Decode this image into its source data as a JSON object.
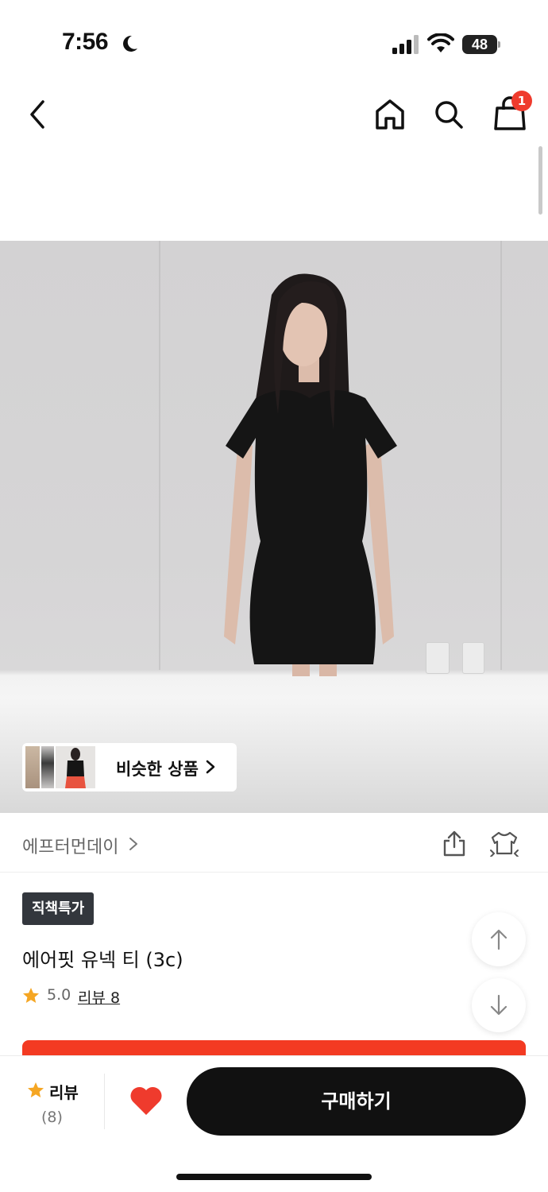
{
  "status_bar": {
    "time": "7:56",
    "battery": "48"
  },
  "nav": {
    "cart_count": "1",
    "icons": [
      "back-icon",
      "home-icon",
      "search-icon",
      "shopping-bag-icon"
    ]
  },
  "similar": {
    "label": "비슷한 상품"
  },
  "brand": {
    "name": "에프터먼데이"
  },
  "product": {
    "badge": "직책특가",
    "title": "에어핏 유넥 티 (3c)",
    "rating": "5.0",
    "review_link": "리뷰 8"
  },
  "bottom_bar": {
    "review_label": "리뷰",
    "review_count": "(8)",
    "buy_label": "구매하기"
  },
  "colors": {
    "accent_red": "#ef3b2d",
    "banner_red": "#f33a22",
    "star": "#f5a623",
    "dark": "#111111",
    "badge_bg": "#33373d"
  }
}
